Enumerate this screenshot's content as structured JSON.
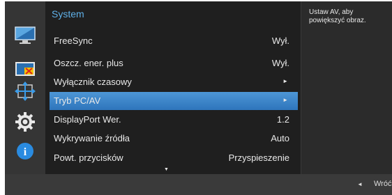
{
  "menu": {
    "title": "System",
    "items": [
      {
        "label": "FreeSync",
        "value": "Wył.",
        "arrow": ""
      },
      {
        "label": "Oszcz. ener. plus",
        "value": "Wył.",
        "arrow": ""
      },
      {
        "label": "Wyłącznik czasowy",
        "value": "",
        "arrow": "►"
      },
      {
        "label": "Tryb PC/AV",
        "value": "",
        "arrow": "►",
        "selected": true
      },
      {
        "label": "DisplayPort Wer.",
        "value": "1.2",
        "arrow": ""
      },
      {
        "label": "Wykrywanie źródła",
        "value": "Auto",
        "arrow": ""
      },
      {
        "label": "Powt. przycisków",
        "value": "Przyspieszenie",
        "arrow": ""
      }
    ],
    "scroll_indicator": "▼"
  },
  "help": {
    "text": "Ustaw AV, aby powiększyć obraz."
  },
  "footer": {
    "back_arrow": "◄",
    "back_label": "Wróć"
  },
  "sidebar": {
    "icons": [
      "picture-icon",
      "color-icon",
      "size-position-icon",
      "settings-gear-icon",
      "information-icon"
    ],
    "info_glyph": "i"
  },
  "colors": {
    "accent": "#5fb0e8",
    "selection": "#3f88cc",
    "menu_bg": "#1f1f1f",
    "sidebar_bg": "#353535"
  }
}
